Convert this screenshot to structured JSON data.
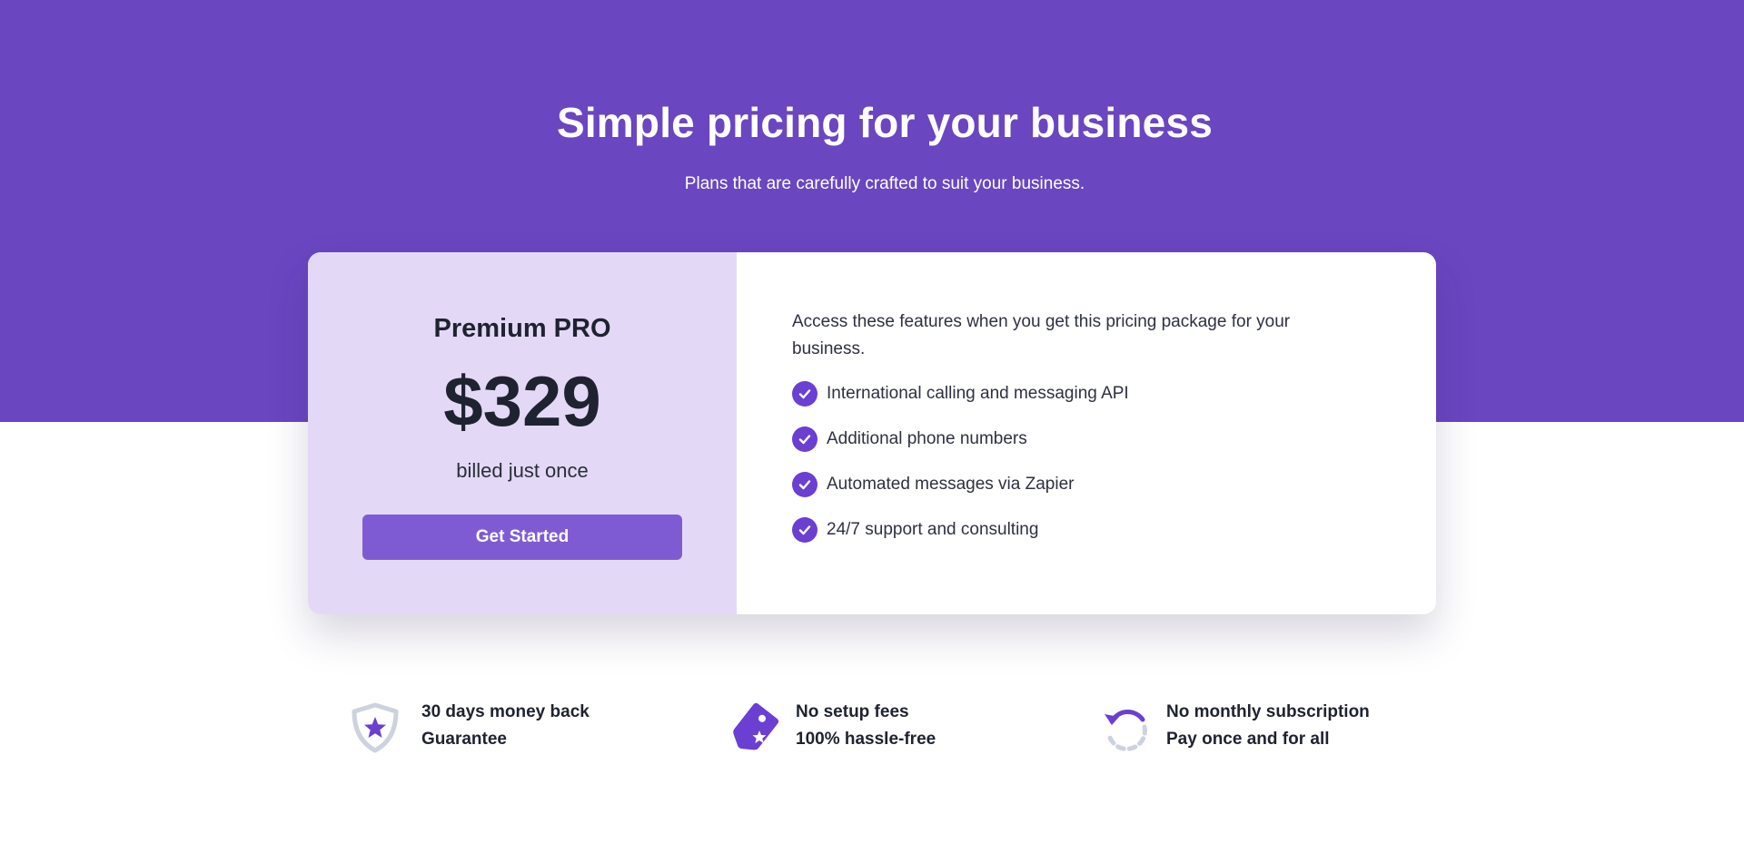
{
  "colors": {
    "hero_background": "#6a46c1",
    "card_left_background": "#e3d9f6",
    "button_background": "#7f5bd3",
    "check_icon": "#6a3fd1",
    "text_dark": "#1f2230"
  },
  "hero": {
    "title": "Simple pricing for your business",
    "subtitle": "Plans that are carefully crafted to suit your business."
  },
  "plan": {
    "name": "Premium PRO",
    "price": "$329",
    "billing": "billed just once",
    "cta_label": "Get Started"
  },
  "features": {
    "intro": "Access these features when you get this pricing package for your business.",
    "items": [
      {
        "label": "International calling and messaging API",
        "icon": "check-circle-icon"
      },
      {
        "label": "Additional phone numbers",
        "icon": "check-circle-icon"
      },
      {
        "label": "Automated messages via Zapier",
        "icon": "check-circle-icon"
      },
      {
        "label": "24/7 support and consulting",
        "icon": "check-circle-icon"
      }
    ]
  },
  "guarantees": [
    {
      "icon": "shield-star-icon",
      "line1": "30 days money back",
      "line2": "Guarantee"
    },
    {
      "icon": "price-tag-icon",
      "line1": "No setup fees",
      "line2": "100% hassle-free"
    },
    {
      "icon": "refresh-cycle-icon",
      "line1": "No monthly subscription",
      "line2": "Pay once and for all"
    }
  ]
}
